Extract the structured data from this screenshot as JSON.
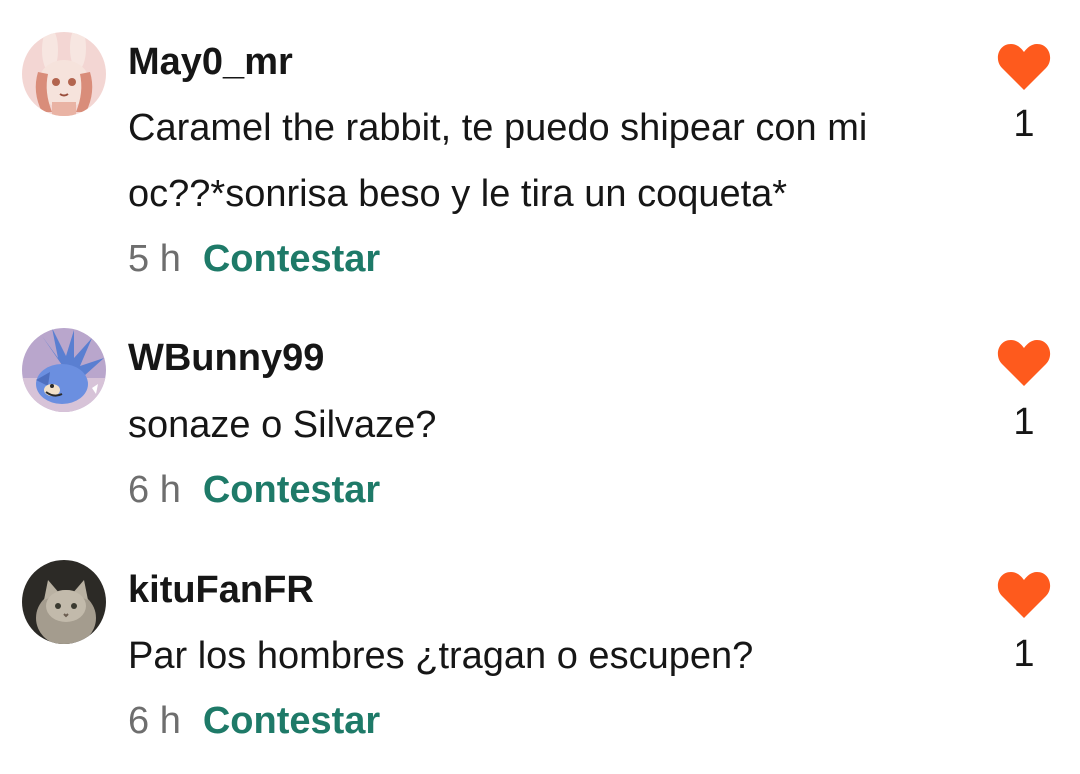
{
  "comments": [
    {
      "username": "May0_mr",
      "text": "Caramel the rabbit, te puedo shipear con mi oc??*sonrisa beso y le tira un coqueta*",
      "time": "5 h",
      "reply_label": "Contestar",
      "likes": "1",
      "avatar_icon": "rabbit-character-avatar"
    },
    {
      "username": "WBunny99",
      "text": "sonaze o Silvaze?",
      "time": "6 h",
      "reply_label": "Contestar",
      "likes": "1",
      "avatar_icon": "blue-hedgehog-avatar"
    },
    {
      "username": "kituFanFR",
      "text": "Par los hombres ¿tragan o escupen?",
      "time": "6 h",
      "reply_label": "Contestar",
      "likes": "1",
      "avatar_icon": "cat-photo-avatar"
    }
  ],
  "colors": {
    "heart": "#fe5a1d",
    "reply": "#1e7a68",
    "time": "#6e6e6e",
    "text": "#161616"
  }
}
